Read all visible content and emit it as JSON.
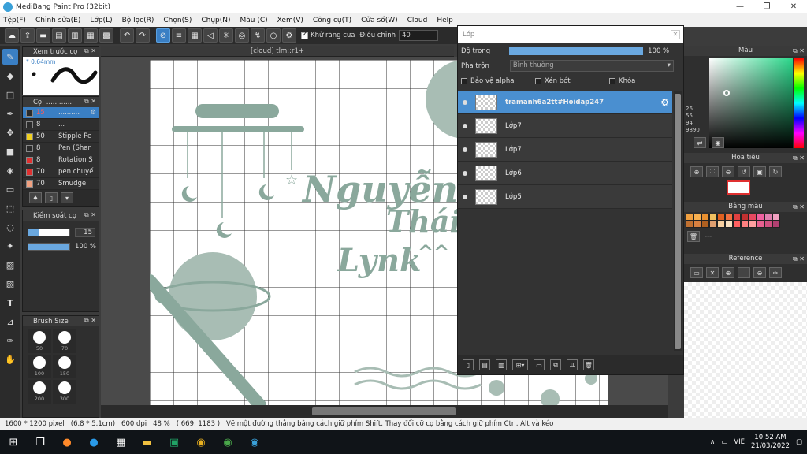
{
  "window": {
    "title": "MediBang Paint Pro (32bit)"
  },
  "menu": [
    "Tệp(F)",
    "Chỉnh sửa(E)",
    "Lớp(L)",
    "Bộ lọc(R)",
    "Chọn(S)",
    "Chụp(N)",
    "Màu (C)",
    "Xem(V)",
    "Công cụ(T)",
    "Cửa sổ(W)",
    "Cloud",
    "Help"
  ],
  "toolbar": {
    "antialias_label": "Khử răng cưa",
    "adjust_label": "Điều chỉnh",
    "adjust_value": "40"
  },
  "canvas": {
    "tab_title": "[cloud] tlm::r1+"
  },
  "brush_preview": {
    "title": "Xem trước cọ",
    "size": "0.64mm"
  },
  "brush_list": {
    "title": "Cọ: ............",
    "items": [
      {
        "size": "15",
        "name": "..........",
        "color": "#2a2a2a",
        "selected": true
      },
      {
        "size": "8",
        "name": "...",
        "color": "#2a2a2a",
        "selected": false
      },
      {
        "size": "50",
        "name": "Stipple Pe",
        "color": "#f0d020",
        "selected": false
      },
      {
        "size": "8",
        "name": "Pen (Shar",
        "color": "#2a2a2a",
        "selected": false
      },
      {
        "size": "8",
        "name": "Rotation S",
        "color": "#e03030",
        "selected": false
      },
      {
        "size": "70",
        "name": "pen chuyế",
        "color": "#e03030",
        "selected": false
      },
      {
        "size": "70",
        "name": "Smudge",
        "color": "#f0a080",
        "selected": false
      }
    ]
  },
  "brush_control": {
    "title": "Kiểm soát cọ",
    "size_value": "15",
    "size_fill": 0.25,
    "opacity_value": "100 %",
    "opacity_fill": 1.0
  },
  "brush_size": {
    "title": "Brush Size",
    "sizes": [
      "50",
      "70",
      "100",
      "150",
      "200",
      "300"
    ]
  },
  "layer_panel": {
    "title": "Lớp",
    "opacity_label": "Độ trong",
    "opacity_value": "100 %",
    "blend_label": "Pha trộn",
    "blend_value": "Bình thường",
    "protect_alpha": "Bảo vệ alpha",
    "clipping": "Xén bớt",
    "lock": "Khóa",
    "layers": [
      {
        "name": "tramanh6a2tt#Hoidap247",
        "selected": true
      },
      {
        "name": "Lớp7",
        "selected": false
      },
      {
        "name": "Lớp7",
        "selected": false
      },
      {
        "name": "Lớp6",
        "selected": false
      },
      {
        "name": "Lớp5",
        "selected": false
      }
    ]
  },
  "color_panel": {
    "title": "Màu",
    "hex_partial": "9890",
    "values": [
      "26",
      "55",
      "94"
    ]
  },
  "navigator": {
    "title": "Hoa tiêu"
  },
  "palette": {
    "title": "Bảng màu",
    "label": "---",
    "colors": [
      "#f0a040",
      "#f8b050",
      "#e89030",
      "#f0c060",
      "#e06020",
      "#f07040",
      "#e04040",
      "#c03030",
      "#e84860",
      "#f060a0",
      "#e080b0",
      "#f0a0c0",
      "#c07030",
      "#d88040",
      "#b06020",
      "#e0a070",
      "#f8d0a0",
      "#f8e0c0",
      "#ff6060",
      "#ff8080",
      "#ffa0a0",
      "#e86090",
      "#d05080",
      "#b04070"
    ]
  },
  "reference": {
    "title": "Reference"
  },
  "artwork": {
    "line1": "Nguyễn",
    "line2": "Thái",
    "line3": "Lynk",
    "deco": "^^"
  },
  "status": {
    "dimensions": "1600 * 1200 pixel",
    "physical": "(6.8 * 5.1cm)",
    "dpi": "600 dpi",
    "zoom": "48 %",
    "cursor": "( 669, 1183 )",
    "hint": "Vẽ một đường thẳng bằng cách giữ phím Shift, Thay đổi cỡ cọ bằng cách giữ phím Ctrl, Alt và kéo"
  },
  "taskbar": {
    "lang": "VIE",
    "time": "10:52 AM",
    "date": "21/03/2022"
  }
}
